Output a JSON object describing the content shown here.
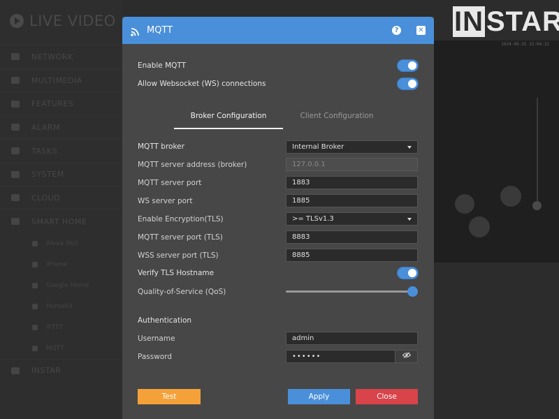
{
  "background": {
    "app_title": "LIVE VIDEO",
    "menu": [
      {
        "label": "NETWORK",
        "icon": "network-icon"
      },
      {
        "label": "MULTIMEDIA",
        "icon": "image-icon"
      },
      {
        "label": "FEATURES",
        "icon": "star-icon"
      },
      {
        "label": "ALARM",
        "icon": "bell-icon"
      },
      {
        "label": "TASKS",
        "icon": "calendar-icon"
      },
      {
        "label": "SYSTEM",
        "icon": "gear-icon"
      },
      {
        "label": "CLOUD",
        "icon": "cloud-icon"
      },
      {
        "label": "SMART HOME",
        "icon": "home-icon"
      }
    ],
    "submenu": [
      {
        "label": "Alexa Skill"
      },
      {
        "label": "iFrame"
      },
      {
        "label": "Google Home"
      },
      {
        "label": "Homekit"
      },
      {
        "label": "IFTTT"
      },
      {
        "label": "MQTT"
      }
    ],
    "footer_item": "INSTAR",
    "logo_in": "IN",
    "logo_star": "STAR",
    "timestamp": "2024-09-25 15:04:32"
  },
  "modal": {
    "title": "MQTT",
    "toggles": [
      {
        "label": "Enable MQTT",
        "on": true
      },
      {
        "label": "Allow Websocket (WS) connections",
        "on": true
      }
    ],
    "tabs": {
      "active": "Broker Configuration",
      "inactive": "Client Configuration"
    },
    "fields": {
      "broker_label": "MQTT broker",
      "broker_value": "Internal Broker",
      "address_label": "MQTT server address (broker)",
      "address_value": "127.0.0.1",
      "port_label": "MQTT server port",
      "port_value": "1883",
      "ws_port_label": "WS server port",
      "ws_port_value": "1885",
      "tls_label": "Enable Encryption(TLS)",
      "tls_value": ">= TLSv1.3",
      "tls_port_label": "MQTT server port (TLS)",
      "tls_port_value": "8883",
      "wss_port_label": "WSS server port (TLS)",
      "wss_port_value": "8885",
      "verify_label": "Verify TLS Hostname",
      "qos_label": "Quality-of-Service (QoS)",
      "qos_level": 1.0
    },
    "auth": {
      "heading": "Authentication",
      "username_label": "Username",
      "username_value": "admin",
      "password_label": "Password",
      "password_value": "••••••"
    },
    "buttons": {
      "test": "Test",
      "apply": "Apply",
      "close": "Close"
    },
    "colors": {
      "accent": "#4a8fd9",
      "test": "#f5a13a",
      "close": "#d9434a"
    }
  }
}
